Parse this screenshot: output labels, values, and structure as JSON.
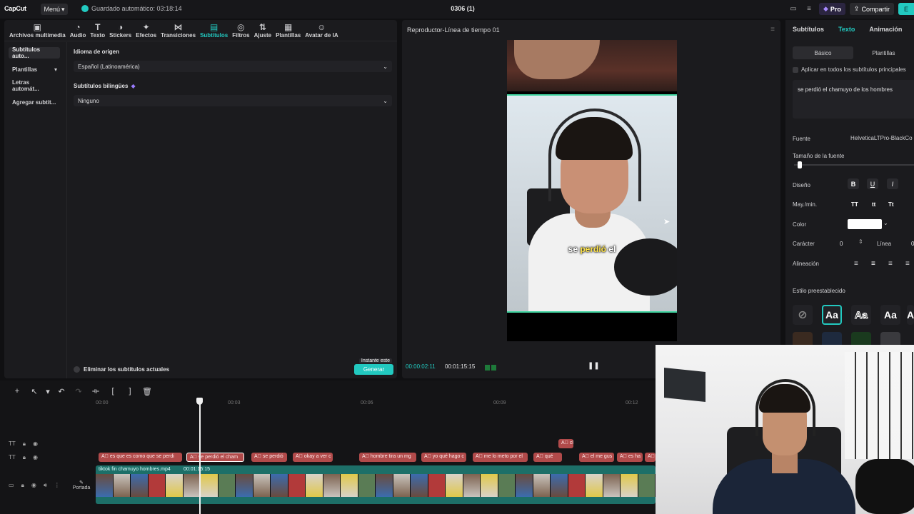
{
  "topbar": {
    "logo": "CapCut",
    "menu_label": "Menú",
    "autosave": "Guardado automático: 03:18:14",
    "project_title": "0306 (1)",
    "pro_label": "Pro",
    "share_label": "Compartir",
    "export_label": "E"
  },
  "toolbar": {
    "items": [
      {
        "label": "Archivos multimedia",
        "icon": "media-icon"
      },
      {
        "label": "Audio",
        "icon": "audio-icon"
      },
      {
        "label": "Texto",
        "icon": "text-icon"
      },
      {
        "label": "Stickers",
        "icon": "sticker-icon"
      },
      {
        "label": "Efectos",
        "icon": "effects-icon"
      },
      {
        "label": "Transiciones",
        "icon": "transitions-icon"
      },
      {
        "label": "Subtítulos",
        "icon": "subtitles-icon",
        "active": true
      },
      {
        "label": "Filtros",
        "icon": "filters-icon"
      },
      {
        "label": "Ajuste",
        "icon": "adjust-icon"
      },
      {
        "label": "Plantillas",
        "icon": "templates-icon"
      },
      {
        "label": "Avatar de IA",
        "icon": "ai-avatar-icon"
      }
    ]
  },
  "sidebar": {
    "items": [
      {
        "label": "Subtítulos auto...",
        "active": true
      },
      {
        "label": "Plantillas",
        "has_dropdown": true
      },
      {
        "label": "Letras automát..."
      },
      {
        "label": "Agregar subtít..."
      }
    ]
  },
  "subtitles_form": {
    "source_language_label": "Idioma de origen",
    "source_language_value": "Español (Latinoamérica)",
    "bilingual_label": "Subtítulos bilingües",
    "bilingual_value": "Ninguno",
    "remove_current_label": "Eliminar los subtítulos actuales",
    "generate_label": "Generar",
    "instant_tip": "Instante este"
  },
  "player": {
    "title": "Reproductor-Línea de tiempo 01",
    "caption_before": "se ",
    "caption_highlight": "perdió",
    "caption_after": " el",
    "time_current": "00:00:02:11",
    "time_total": "00:01:15:15"
  },
  "right_panel": {
    "tabs": [
      "Subtítulos",
      "Texto",
      "Animación",
      "S"
    ],
    "active_tab": "Texto",
    "subtabs": [
      "Básico",
      "Plantillas"
    ],
    "apply_all_label": "Aplicar en todos los subtítulos principales",
    "text_value": "se perdió el chamuyo de los hombres",
    "font_label": "Fuente",
    "font_value": "HelveticaLTPro-BlackCo",
    "font_size_label": "Tamaño de la fuente",
    "font_size_fraction": 0.03,
    "design_label": "Diseño",
    "design_buttons": [
      "B",
      "U",
      "I"
    ],
    "case_label": "May./min.",
    "case_buttons": [
      "TT",
      "tt",
      "Tt"
    ],
    "color_label": "Color",
    "color_value": "#ffffff",
    "character_label": "Carácter",
    "character_value": "0",
    "line_label": "Línea",
    "line_value": "0",
    "alignment_label": "Alineación",
    "preset_label": "Estilo preestablecido",
    "presets": [
      "Aa",
      "Aa",
      "Aa",
      "A"
    ]
  },
  "timeline": {
    "ticks": [
      "00:00",
      "00:03",
      "00:06",
      "00:09",
      "00:12"
    ],
    "subtitle_clips": [
      "es que es como que se perdi",
      "se perdió el cham",
      "se perdió",
      "okay a ver c",
      "hombre tira un mg",
      "yo qué hago c",
      "me lo meto por el",
      "qué",
      "el me gus",
      "es ha",
      "",
      "cl"
    ],
    "video_clip_name": "tiktok fin chamuyo hombres.mp4",
    "video_clip_duration": "00:01:15:15",
    "cover_label": "Portada"
  },
  "colors": {
    "accent": "#22c9c0",
    "subtitle_clip": "#b14a4a",
    "video_clip": "#1d6f68"
  }
}
